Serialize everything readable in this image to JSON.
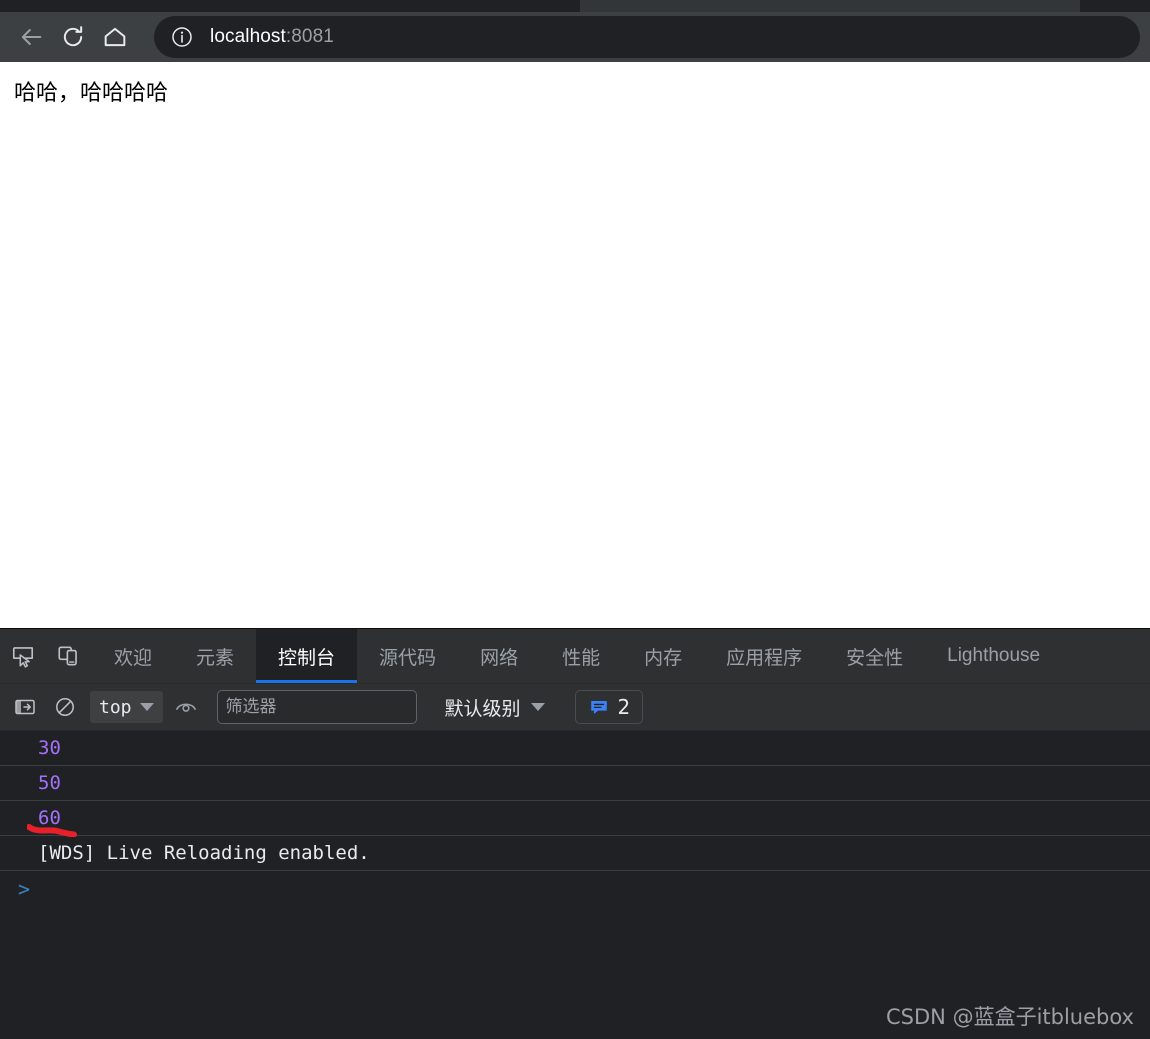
{
  "browser": {
    "nav": {
      "back_label": "Back",
      "reload_label": "Reload",
      "home_label": "Home"
    },
    "omnibox": {
      "host": "localhost",
      "port": ":8081",
      "info_icon": "info-circle-icon"
    }
  },
  "page": {
    "body_text": "哈哈，哈哈哈哈"
  },
  "devtools": {
    "icons": {
      "inspect": "inspect-element-icon",
      "device": "device-toolbar-icon"
    },
    "tabs": [
      {
        "label": "欢迎",
        "active": false,
        "latin": false
      },
      {
        "label": "元素",
        "active": false,
        "latin": false
      },
      {
        "label": "控制台",
        "active": true,
        "latin": false
      },
      {
        "label": "源代码",
        "active": false,
        "latin": false
      },
      {
        "label": "网络",
        "active": false,
        "latin": false
      },
      {
        "label": "性能",
        "active": false,
        "latin": false
      },
      {
        "label": "内存",
        "active": false,
        "latin": false
      },
      {
        "label": "应用程序",
        "active": false,
        "latin": false
      },
      {
        "label": "安全性",
        "active": false,
        "latin": false
      },
      {
        "label": "Lighthouse",
        "active": false,
        "latin": true
      }
    ],
    "toolbar": {
      "sidebar_toggle_icon": "console-sidebar-icon",
      "clear_console_icon": "clear-console-icon",
      "context_value": "top",
      "live_expression_icon": "eye-icon",
      "filter_placeholder": "筛选器",
      "filter_value": "",
      "level_label": "默认级别",
      "message_count": "2",
      "message_icon": "speech-bubble-icon"
    },
    "console": {
      "rows": [
        {
          "type": "number",
          "text": "30"
        },
        {
          "type": "number",
          "text": "50"
        },
        {
          "type": "number",
          "text": "60"
        },
        {
          "type": "text",
          "text": "[WDS] Live Reloading enabled."
        }
      ],
      "prompt": ">"
    },
    "annotation_color": "#e8202a"
  },
  "watermark": "CSDN @蓝盒子itbluebox",
  "colors": {
    "accent_blue": "#1a73e8",
    "number_purple": "#a371f7",
    "devtools_bg": "#202124",
    "toolbar_bg": "#2f3032"
  }
}
